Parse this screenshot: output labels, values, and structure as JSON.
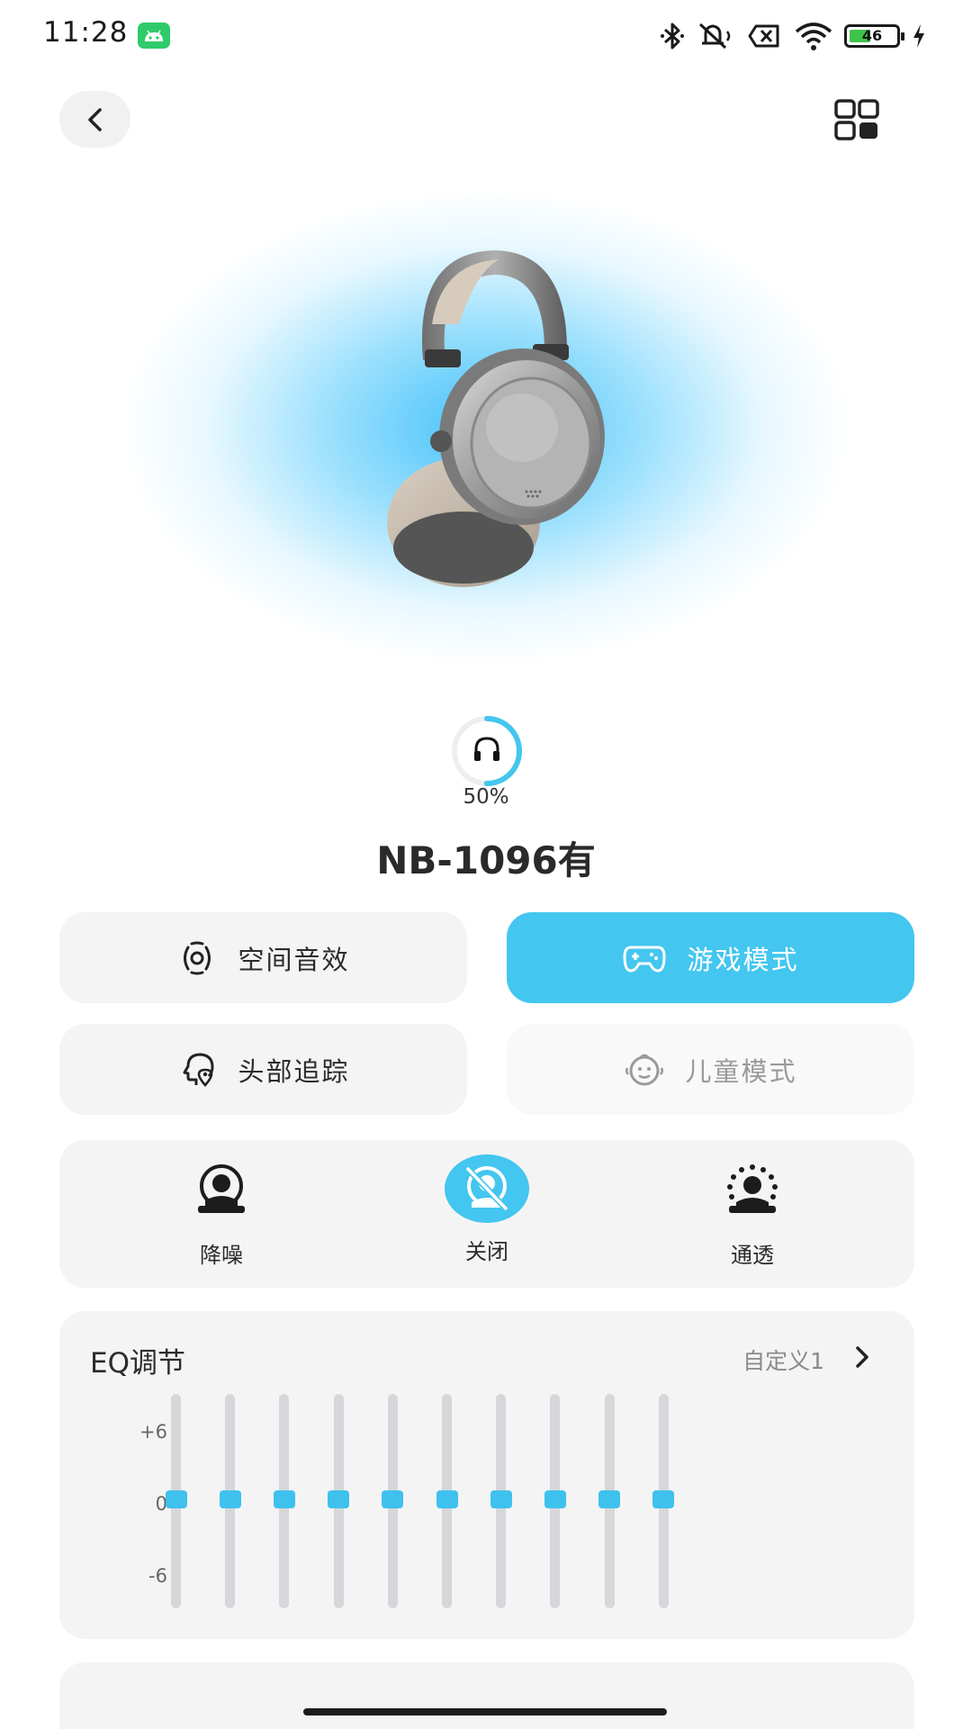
{
  "status_bar": {
    "time": "11:28",
    "icons": [
      "android-icon",
      "bluetooth-icon",
      "silent-icon",
      "sim-error-icon",
      "wifi-icon",
      "battery-icon",
      "charging-icon"
    ],
    "battery_level": "46",
    "battery_fraction": 0.46
  },
  "nav": {
    "back_icon": "chevron-left-icon",
    "menu_icon": "grid-menu-icon"
  },
  "device": {
    "battery_percent_label": "50%",
    "battery_fraction": 0.5,
    "name": "NB-1096有"
  },
  "modes": [
    {
      "label": "空间音效",
      "icon": "spatial-audio-icon",
      "state": "normal"
    },
    {
      "label": "游戏模式",
      "icon": "gamepad-icon",
      "state": "active"
    },
    {
      "label": "头部追踪",
      "icon": "head-tracking-icon",
      "state": "normal"
    },
    {
      "label": "儿童模式",
      "icon": "child-face-icon",
      "state": "disabled"
    }
  ],
  "anc": {
    "options": [
      {
        "label": "降噪",
        "icon": "noise-cancel-icon"
      },
      {
        "label": "关闭",
        "icon": "anc-off-icon",
        "selected": true
      },
      {
        "label": "通透",
        "icon": "transparency-icon"
      }
    ]
  },
  "eq": {
    "title": "EQ调节",
    "preset": "自定义1",
    "scale": {
      "top": "+6",
      "mid": "0",
      "bottom": "-6"
    },
    "bands": [
      0,
      0,
      0,
      0,
      0,
      0,
      0,
      0,
      0,
      0
    ]
  },
  "colors": {
    "accent": "#43c6ef",
    "card_bg": "#f4f4f4",
    "track": "#d5d7da"
  }
}
